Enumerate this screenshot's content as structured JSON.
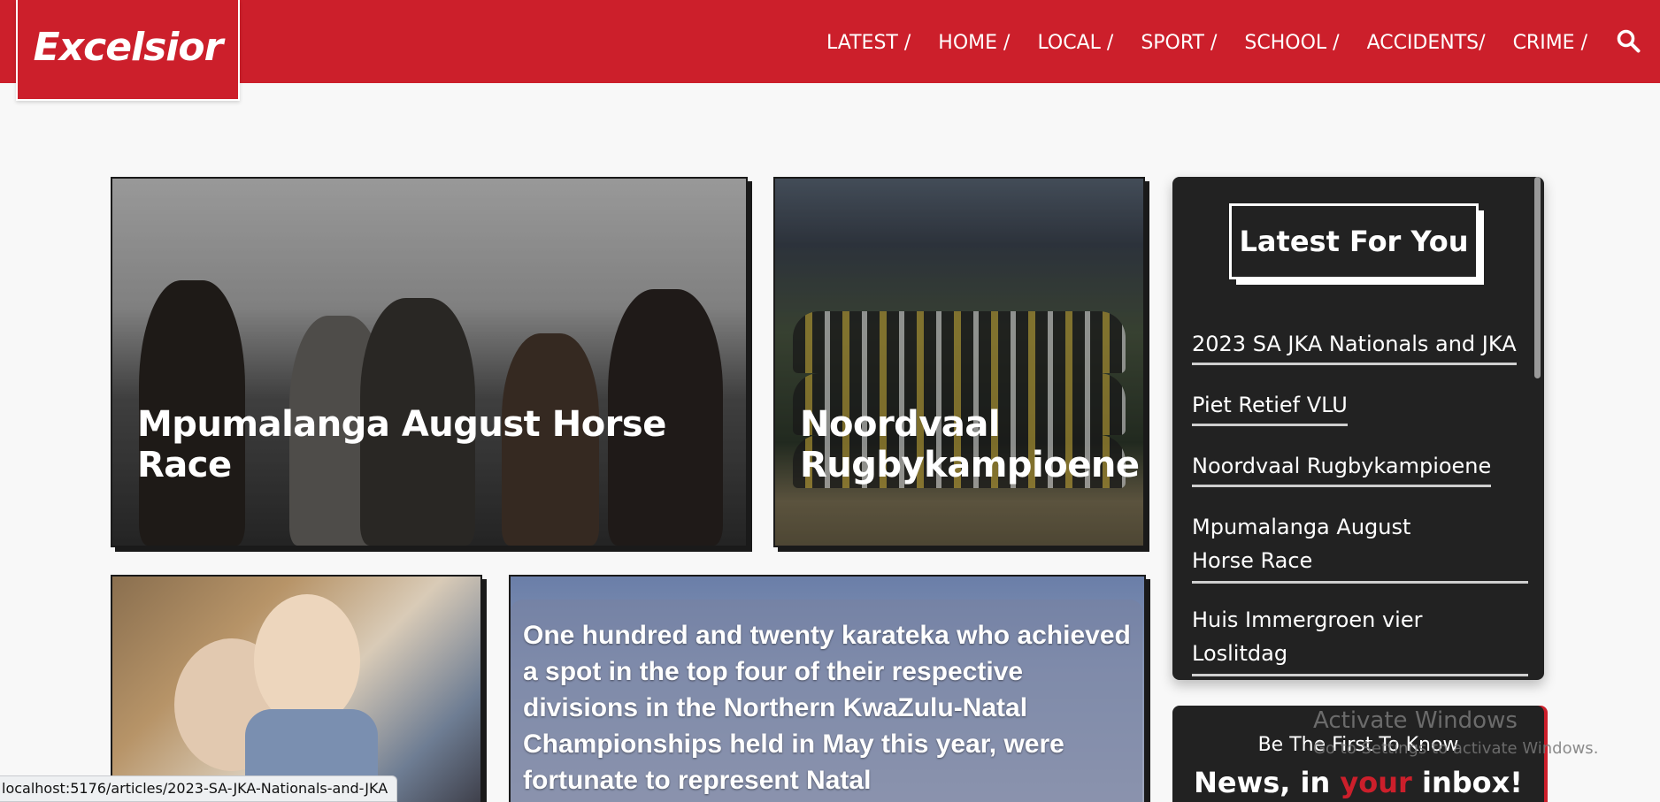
{
  "header": {
    "logo": "Excelsior",
    "nav": [
      {
        "label": "LATEST /"
      },
      {
        "label": "HOME /"
      },
      {
        "label": "LOCAL /"
      },
      {
        "label": "SPORT /"
      },
      {
        "label": "SCHOOL /"
      },
      {
        "label": "ACCIDENTS/"
      },
      {
        "label": "CRIME /"
      }
    ]
  },
  "cards": {
    "horse": {
      "title": "Mpumalanga August Horse Race"
    },
    "rugby": {
      "title": "Noordvaal Rugbykampioene"
    },
    "karate": {
      "text": "One hundred and twenty karateka who achieved a spot in the top four of their respective divisions in the Northern KwaZulu-Natal Championships held in May this year, were fortunate to represent Natal"
    }
  },
  "sidebar": {
    "heading": "Latest For You",
    "items": [
      {
        "label": "2023 SA JKA Nationals and JKA"
      },
      {
        "label": "Piet Retief VLU"
      },
      {
        "label": "Noordvaal Rugbykampioene"
      },
      {
        "label": "Mpumalanga August Horse Race"
      },
      {
        "label": "Huis Immergroen vier Loslitdag"
      }
    ]
  },
  "newsletter": {
    "small": "Be The First To Know",
    "big_pre": "News, in ",
    "big_red": "your",
    "big_post": " inbox!"
  },
  "watermark": {
    "line1": "Activate Windows",
    "line2": "Go to Settings to activate Windows."
  },
  "status_url": "localhost:5176/articles/2023-SA-JKA-Nationals-and-JKA",
  "colors": {
    "brand_red": "#cc1f2b",
    "sidebar_bg": "#222222",
    "page_bg": "#f8f8f8"
  }
}
